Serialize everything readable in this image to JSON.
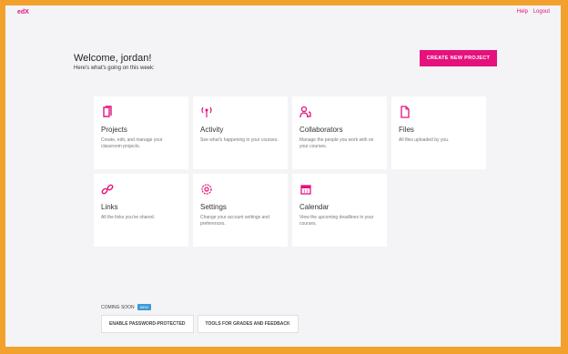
{
  "app": {
    "logo": "edX"
  },
  "header_links": [
    "Help",
    "Logout"
  ],
  "welcome": {
    "title": "Welcome, jordan!",
    "subtitle": "Here's what's going on this week:"
  },
  "create_button_label": "CREATE NEW PROJECT",
  "cards": [
    {
      "id": "projects",
      "title": "Projects",
      "desc": "Create, edit, and manage your classroom projects.",
      "icon": "document-icon"
    },
    {
      "id": "activity",
      "title": "Activity",
      "desc": "See what's happening in your courses.",
      "icon": "activity-icon"
    },
    {
      "id": "collaborators",
      "title": "Collaborators",
      "desc": "Manage the people you work with on your courses.",
      "icon": "collaborators-icon"
    },
    {
      "id": "files",
      "title": "Files",
      "desc": "All files uploaded by you.",
      "icon": "file-icon"
    },
    {
      "id": "links",
      "title": "Links",
      "desc": "All the links you've shared.",
      "icon": "link-icon"
    },
    {
      "id": "settings",
      "title": "Settings",
      "desc": "Change your account settings and preferences.",
      "icon": "settings-icon"
    },
    {
      "id": "calendar",
      "title": "Calendar",
      "desc": "View the upcoming deadlines in your courses.",
      "icon": "calendar-icon"
    }
  ],
  "coming_soon": {
    "label": "COMING SOON",
    "badge": "NEW"
  },
  "bottom_buttons": [
    "ENABLE PASSWORD-PROTECTED",
    "TOOLS FOR GRADES AND FEEDBACK"
  ],
  "colors": {
    "accent": "#e5127d",
    "frame": "#f2a22c",
    "badge": "#3b9ad9"
  }
}
